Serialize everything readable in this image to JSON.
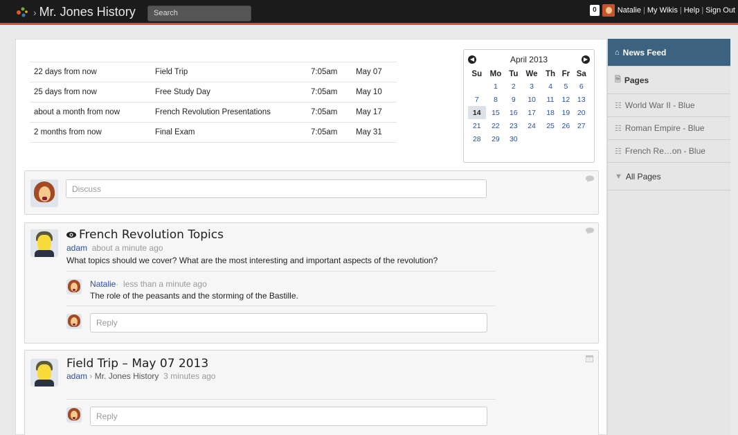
{
  "topbar": {
    "site_title": "Mr. Jones History",
    "search_placeholder": "Search",
    "notifications_count": "0",
    "user_name": "Natalie",
    "links": [
      "My Wikis",
      "Help",
      "Sign Out"
    ],
    "accent_color": "#d9502d"
  },
  "events": [
    {
      "relative": "22 days from now",
      "title": "Field Trip",
      "time": "7:05am",
      "date": "May 07"
    },
    {
      "relative": "25 days from now",
      "title": "Free Study Day",
      "time": "7:05am",
      "date": "May 10"
    },
    {
      "relative": "about a month from now",
      "title": "French Revolution Presentations",
      "time": "7:05am",
      "date": "May 17"
    },
    {
      "relative": "2 months from now",
      "title": "Final Exam",
      "time": "7:05am",
      "date": "May 31"
    }
  ],
  "calendar": {
    "month_label": "April 2013",
    "weekdays": [
      "Su",
      "Mo",
      "Tu",
      "We",
      "Th",
      "Fr",
      "Sa"
    ],
    "weeks": [
      [
        "",
        "1",
        "2",
        "3",
        "4",
        "5",
        "6"
      ],
      [
        "7",
        "8",
        "9",
        "10",
        "11",
        "12",
        "13"
      ],
      [
        "14",
        "15",
        "16",
        "17",
        "18",
        "19",
        "20"
      ],
      [
        "21",
        "22",
        "23",
        "24",
        "25",
        "26",
        "27"
      ],
      [
        "28",
        "29",
        "30",
        "",
        "",
        "",
        ""
      ]
    ],
    "today": "14"
  },
  "discuss": {
    "placeholder": "Discuss"
  },
  "posts": [
    {
      "title": "French Revolution Topics",
      "author": "adam",
      "time": "about a minute ago",
      "body": "What topics should we cover? What are the most interesting and important aspects of the revolution?",
      "comment": {
        "author": "Natalie",
        "time": "less than a minute ago",
        "body": "The role of the peasants and the storming of the Bastille."
      },
      "reply_placeholder": "Reply"
    },
    {
      "title": "Field Trip – May 07 2013",
      "author": "adam",
      "context": "Mr. Jones History",
      "time": "3 minutes ago",
      "reply_placeholder": "Reply"
    }
  ],
  "sidebar": {
    "news_feed": "News Feed",
    "pages": "Pages",
    "page_items": [
      "World War II - Blue",
      "Roman Empire - Blue",
      "French Re…on - Blue"
    ],
    "all_pages": "All Pages",
    "active_color": "#3c6280"
  }
}
